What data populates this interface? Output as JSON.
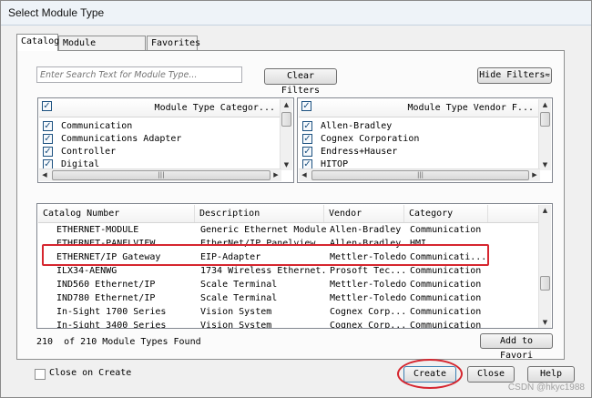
{
  "window": {
    "title": "Select Module Type"
  },
  "tabs": [
    {
      "label": "Catalog"
    },
    {
      "label": "Module Discovery"
    },
    {
      "label": "Favorites"
    }
  ],
  "search": {
    "placeholder": "Enter Search Text for Module Type..."
  },
  "buttons": {
    "clear_filters": "Clear Filters",
    "hide_filters": "Hide Filters",
    "hide_filters_icon": "≈",
    "add_to_favorites": "Add to Favori",
    "create": "Create",
    "close": "Close",
    "help": "Help"
  },
  "category_filter": {
    "header": "Module Type Categor...",
    "items": [
      {
        "label": "Communication",
        "checked": true
      },
      {
        "label": "Communications Adapter",
        "checked": true
      },
      {
        "label": "Controller",
        "checked": true
      },
      {
        "label": "Digital",
        "checked": true
      }
    ]
  },
  "vendor_filter": {
    "header": "Module Type Vendor F...",
    "items": [
      {
        "label": "Allen-Bradley",
        "checked": true
      },
      {
        "label": "Cognex Corporation",
        "checked": true
      },
      {
        "label": "Endress+Hauser",
        "checked": true
      },
      {
        "label": "HITOP",
        "checked": true
      }
    ]
  },
  "catalog": {
    "columns": [
      "Catalog Number",
      "Description",
      "Vendor",
      "Category"
    ],
    "rows": [
      [
        "ETHERNET-MODULE",
        "Generic Ethernet Module",
        "Allen-Bradley",
        "Communication"
      ],
      [
        "ETHERNET-PANELVIEW",
        "EtherNet/IP Panelview",
        "Allen-Bradley",
        "HMI"
      ],
      [
        "ETHERNET/IP Gateway",
        "EIP-Adapter",
        "Mettler-Toledo",
        "Communicati..."
      ],
      [
        "ILX34-AENWG",
        "1734 Wireless Ethernet...",
        "Prosoft Tec...",
        "Communication"
      ],
      [
        "IND560 Ethernet/IP",
        "Scale Terminal",
        "Mettler-Toledo",
        "Communication"
      ],
      [
        "IND780 Ethernet/IP",
        "Scale Terminal",
        "Mettler-Toledo",
        "Communication"
      ],
      [
        "In-Sight 1700 Series",
        "Vision System",
        "Cognex Corp...",
        "Communication"
      ],
      [
        "In-Sight 3400 Series",
        "Vision System",
        "Cognex Corp...",
        "Communication"
      ]
    ],
    "highlighted_row": 2
  },
  "status": {
    "found_count": "210",
    "found_text": "of 210 Module Types Found"
  },
  "close_on_create": {
    "label": "Close on Create",
    "checked": false
  },
  "scroll_glyphs": {
    "up": "▲",
    "down": "▼",
    "left": "◀",
    "right": "▶",
    "grip": "|||"
  },
  "check_glyph": "✓",
  "watermark": "CSDN @hkyc1988",
  "colors": {
    "highlight": "#d6262f",
    "accent": "#1c5180"
  }
}
